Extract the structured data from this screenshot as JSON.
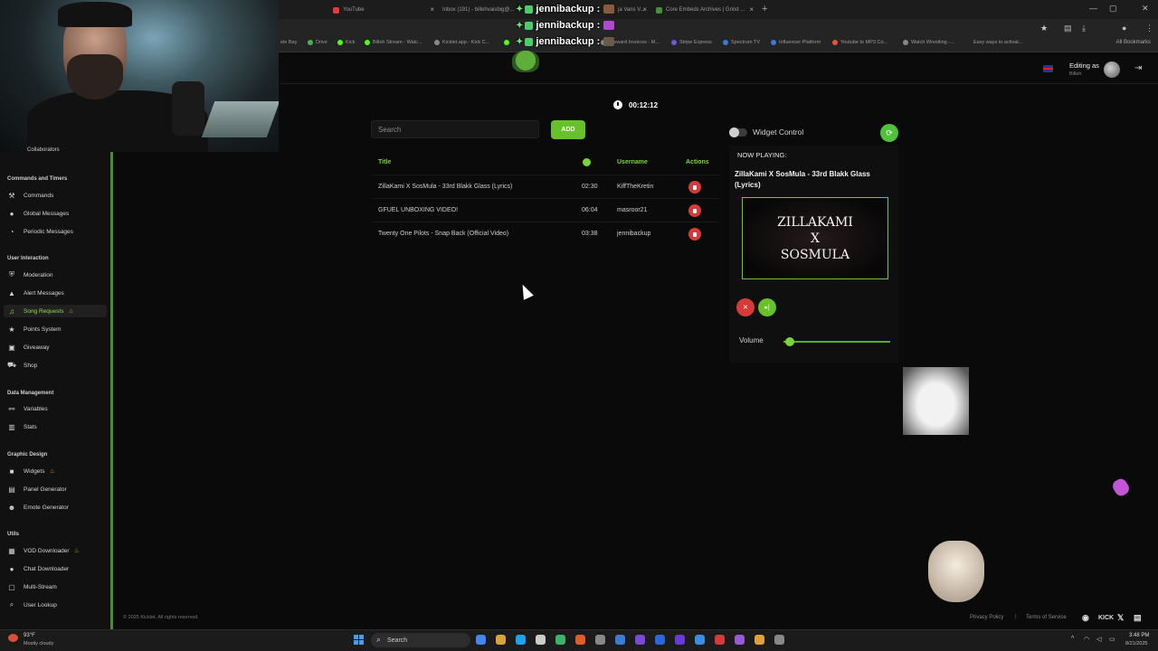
{
  "browser": {
    "tabs": [
      {
        "label": "YouTube",
        "color": "#e33b3b"
      },
      {
        "label": "Inbox (191) - billehvaisbig@...",
        "color": "#d64c3c"
      },
      {
        "label": "ja Vans V...",
        "color": "#777777"
      },
      {
        "label": "Core Embeds Archives | Grind ...",
        "color": "#4a8d3a"
      }
    ],
    "bookmarks": [
      {
        "label": "ele Bay",
        "color": "#777777"
      },
      {
        "label": "Drive",
        "color": "#4caf50"
      },
      {
        "label": "Kick",
        "color": "#53fc18"
      },
      {
        "label": "Billeh Stream - Watc...",
        "color": "#53fc18"
      },
      {
        "label": "Kicklet.app - Kick C...",
        "color": "#888888"
      },
      {
        "label": "",
        "color": "#53fc18"
      },
      {
        "label": "Steward Invoices - M...",
        "color": "#888888"
      },
      {
        "label": "Stripe Express",
        "color": "#6b5bd6"
      },
      {
        "label": "Spectrum TV",
        "color": "#3a7bd5"
      },
      {
        "label": "Influencer Platform",
        "color": "#3a7bd5"
      },
      {
        "label": "Youtube to MP3 Co...",
        "color": "#e0553a"
      },
      {
        "label": "Watch Wrestling -...",
        "color": "#888888"
      },
      {
        "label": "Easy ways to activat...",
        "color": "#888888"
      }
    ],
    "all_bookmarks": "All Bookmarks"
  },
  "chat": [
    {
      "user": "jennibackup :",
      "emote_color": "#8a5a3a"
    },
    {
      "user": "jennibackup :",
      "emote_color": "#b04ad0"
    },
    {
      "user": "jennibackup :",
      "emote_color": "#6b5a4a"
    }
  ],
  "header": {
    "editing_as": "Editing as",
    "editing_user": "Billeh",
    "flag_icon": "uk-flag-icon",
    "logout_icon": "logout-icon"
  },
  "sidebar": {
    "cut_item": "Collaborators",
    "sections": [
      {
        "title": "Commands and Timers",
        "items": [
          {
            "label": "Commands",
            "icon": "wrench-icon",
            "glyph": "⚒"
          },
          {
            "label": "Global Messages",
            "icon": "chat-bubble-icon",
            "glyph": "●"
          },
          {
            "label": "Periodic Messages",
            "icon": "clock-icon",
            "glyph": "◔"
          }
        ]
      },
      {
        "title": "User Interaction",
        "items": [
          {
            "label": "Moderation",
            "icon": "shield-icon",
            "glyph": "⛨"
          },
          {
            "label": "Alert Messages",
            "icon": "warning-icon",
            "glyph": "▲"
          },
          {
            "label": "Song Requests",
            "icon": "music-note-icon",
            "glyph": "♫",
            "active": true,
            "flame": true
          },
          {
            "label": "Points System",
            "icon": "star-icon",
            "glyph": "★"
          },
          {
            "label": "Giveaway",
            "icon": "gift-icon",
            "glyph": "▣"
          },
          {
            "label": "Shop",
            "icon": "cart-icon",
            "glyph": "⛟"
          }
        ]
      },
      {
        "title": "Data Management",
        "items": [
          {
            "label": "Variables",
            "icon": "link-icon",
            "glyph": "⚯"
          },
          {
            "label": "Stats",
            "icon": "bar-chart-icon",
            "glyph": "▥"
          }
        ]
      },
      {
        "title": "Graphic Design",
        "items": [
          {
            "label": "Widgets",
            "icon": "video-icon",
            "glyph": "■",
            "flame": true
          },
          {
            "label": "Panel Generator",
            "icon": "panel-icon",
            "glyph": "▤"
          },
          {
            "label": "Emote Generator",
            "icon": "smiley-icon",
            "glyph": "☻"
          }
        ]
      },
      {
        "title": "Utils",
        "items": [
          {
            "label": "VOD Downloader",
            "icon": "film-icon",
            "glyph": "▦",
            "flame": true
          },
          {
            "label": "Chat Downloader",
            "icon": "chat-icon",
            "glyph": "●"
          },
          {
            "label": "Multi-Stream",
            "icon": "window-icon",
            "glyph": "▢"
          },
          {
            "label": "User Lookup",
            "icon": "search-icon",
            "glyph": "⌕"
          }
        ]
      }
    ]
  },
  "queue": {
    "elapsed": "00:12:12",
    "search_placeholder": "Search",
    "add_label": "ADD",
    "columns": {
      "title": "Title",
      "duration_icon": "clock-icon",
      "username": "Username",
      "actions": "Actions"
    },
    "rows": [
      {
        "title": "ZillaKami X SosMula - 33rd Blakk Glass (Lyrics)",
        "duration": "02:30",
        "user": "KiffTheKretin"
      },
      {
        "title": "GFUEL UNBOXING VIDEO!",
        "duration": "06:04",
        "user": "masroor21"
      },
      {
        "title": "Twenty One Pilots - Snap Back (Official Video)",
        "duration": "03:38",
        "user": "jennibackup"
      }
    ]
  },
  "player": {
    "widget_control": "Widget Control",
    "widget_enabled": false,
    "now_playing_label": "NOW PLAYING:",
    "now_playing_title": "ZillaKami X SosMula - 33rd Blakk Glass (Lyrics)",
    "art_lines": [
      "ZILLAKAMI",
      "X",
      "SOSMULA"
    ],
    "volume_label": "Volume",
    "volume_level": 0.02,
    "accent": "#66c12a",
    "danger": "#d83a3a"
  },
  "footer": {
    "copyright": "© 2025 Kicklet. All rights reserved.",
    "privacy": "Privacy Policy",
    "separator": "|",
    "terms": "Terms of Service"
  },
  "taskbar": {
    "temperature": "93°F",
    "weather": "Mostly cloudy",
    "search_label": "Search",
    "time": "3:48 PM",
    "date": "8/21/2025",
    "apps": [
      "#4285f4",
      "#d8a33a",
      "#1da1f2",
      "#cccccc",
      "#3ab36b",
      "#e05d2a",
      "#888888",
      "#3a7bd5",
      "#7a4ad6",
      "#2a6ad6",
      "#6a3ad6",
      "#3a8de0",
      "#d83a3a",
      "#9b59d6",
      "#e0a03a",
      "#888888"
    ]
  }
}
